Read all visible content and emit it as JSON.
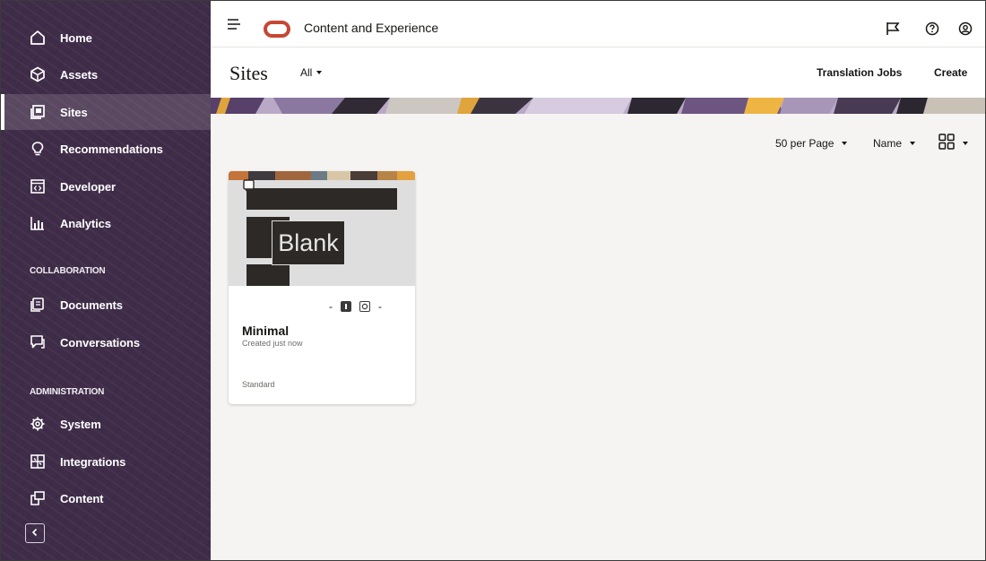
{
  "app": {
    "title": "Content and Experience"
  },
  "sidebar": {
    "items": [
      {
        "label": "Home",
        "icon": "home-icon"
      },
      {
        "label": "Assets",
        "icon": "assets-icon"
      },
      {
        "label": "Sites",
        "icon": "sites-icon",
        "active": true
      },
      {
        "label": "Recommendations",
        "icon": "lightbulb-icon"
      },
      {
        "label": "Developer",
        "icon": "developer-icon"
      },
      {
        "label": "Analytics",
        "icon": "analytics-icon"
      }
    ],
    "collaboration_heading": "COLLABORATION",
    "collaboration_items": [
      {
        "label": "Documents",
        "icon": "documents-icon"
      },
      {
        "label": "Conversations",
        "icon": "conversations-icon"
      }
    ],
    "administration_heading": "ADMINISTRATION",
    "administration_items": [
      {
        "label": "System",
        "icon": "gear-icon"
      },
      {
        "label": "Integrations",
        "icon": "integrations-icon"
      },
      {
        "label": "Content",
        "icon": "content-icon"
      }
    ],
    "collapse_icon": "chevron-left-icon"
  },
  "header": {
    "hamburger_icon": "hamburger-icon",
    "logo": "oracle-logo",
    "icons": [
      "flag-icon",
      "help-icon",
      "user-icon"
    ]
  },
  "page": {
    "title": "Sites",
    "filter": "All",
    "translation_jobs": "Translation Jobs",
    "create": "Create"
  },
  "toolbar": {
    "per_page": "50 per Page",
    "sort": "Name",
    "view_icon": "grid-view-icon"
  },
  "site_card": {
    "thumbnail_text": "Blank",
    "status_separator": "-",
    "name": "Minimal",
    "created": "Created just now",
    "type": "Standard"
  },
  "colors": {
    "sidebar_bg": "#3f2c48",
    "oracle_red": "#c74634",
    "content_bg": "#f5f4f2"
  }
}
